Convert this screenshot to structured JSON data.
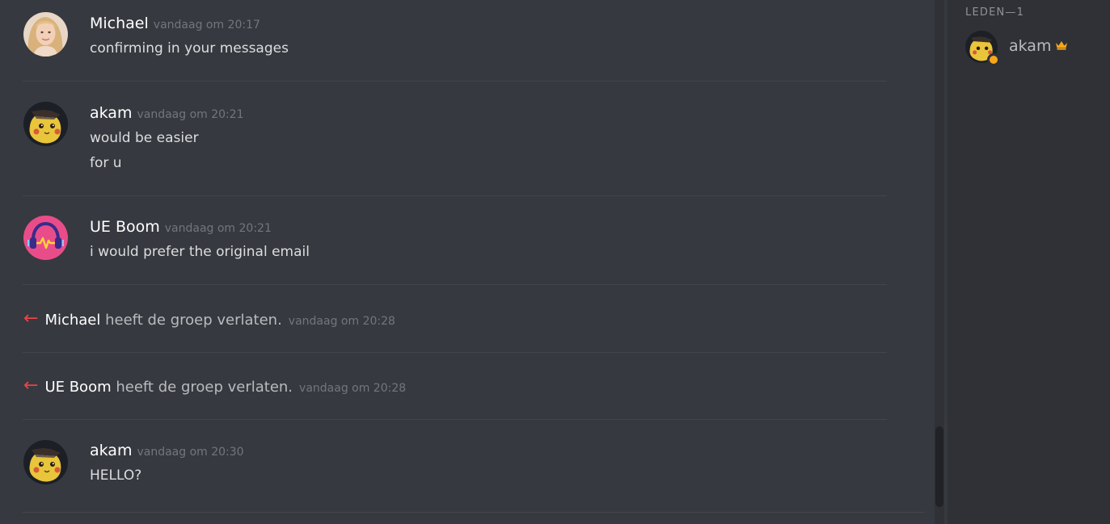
{
  "messages": [
    {
      "username": "Michael",
      "timestamp": "vandaag om 20:17",
      "lines": [
        "confirming in your messages"
      ],
      "avatar": "blonde-woman-avatar"
    },
    {
      "username": "akam",
      "timestamp": "vandaag om 20:21",
      "lines": [
        "would be easier",
        "for u"
      ],
      "avatar": "pikachu-detective-avatar"
    },
    {
      "username": "UE Boom",
      "timestamp": "vandaag om 20:21",
      "lines": [
        "i would prefer the original email"
      ],
      "avatar": "pink-headphones-avatar"
    },
    {
      "username": "akam",
      "timestamp": "vandaag om 20:30",
      "lines": [
        "HELLO?"
      ],
      "avatar": "pikachu-detective-avatar"
    }
  ],
  "system_messages": [
    {
      "who": "Michael",
      "text": "heeft de groep verlaten.",
      "timestamp": "vandaag om 20:28",
      "icon": "leave-arrow-icon"
    },
    {
      "who": "UE Boom",
      "text": "heeft de groep verlaten.",
      "timestamp": "vandaag om 20:28",
      "icon": "leave-arrow-icon"
    }
  ],
  "members": {
    "header": "LEDEN—1",
    "list": [
      {
        "name": "akam",
        "status": "idle",
        "owner": true,
        "status_color": "#faa61a"
      }
    ]
  },
  "colors": {
    "background": "#36393f",
    "sidebar": "#2f3136",
    "leave_arrow": "#ed4245",
    "idle": "#faa61a",
    "crown": "#faa61a"
  }
}
